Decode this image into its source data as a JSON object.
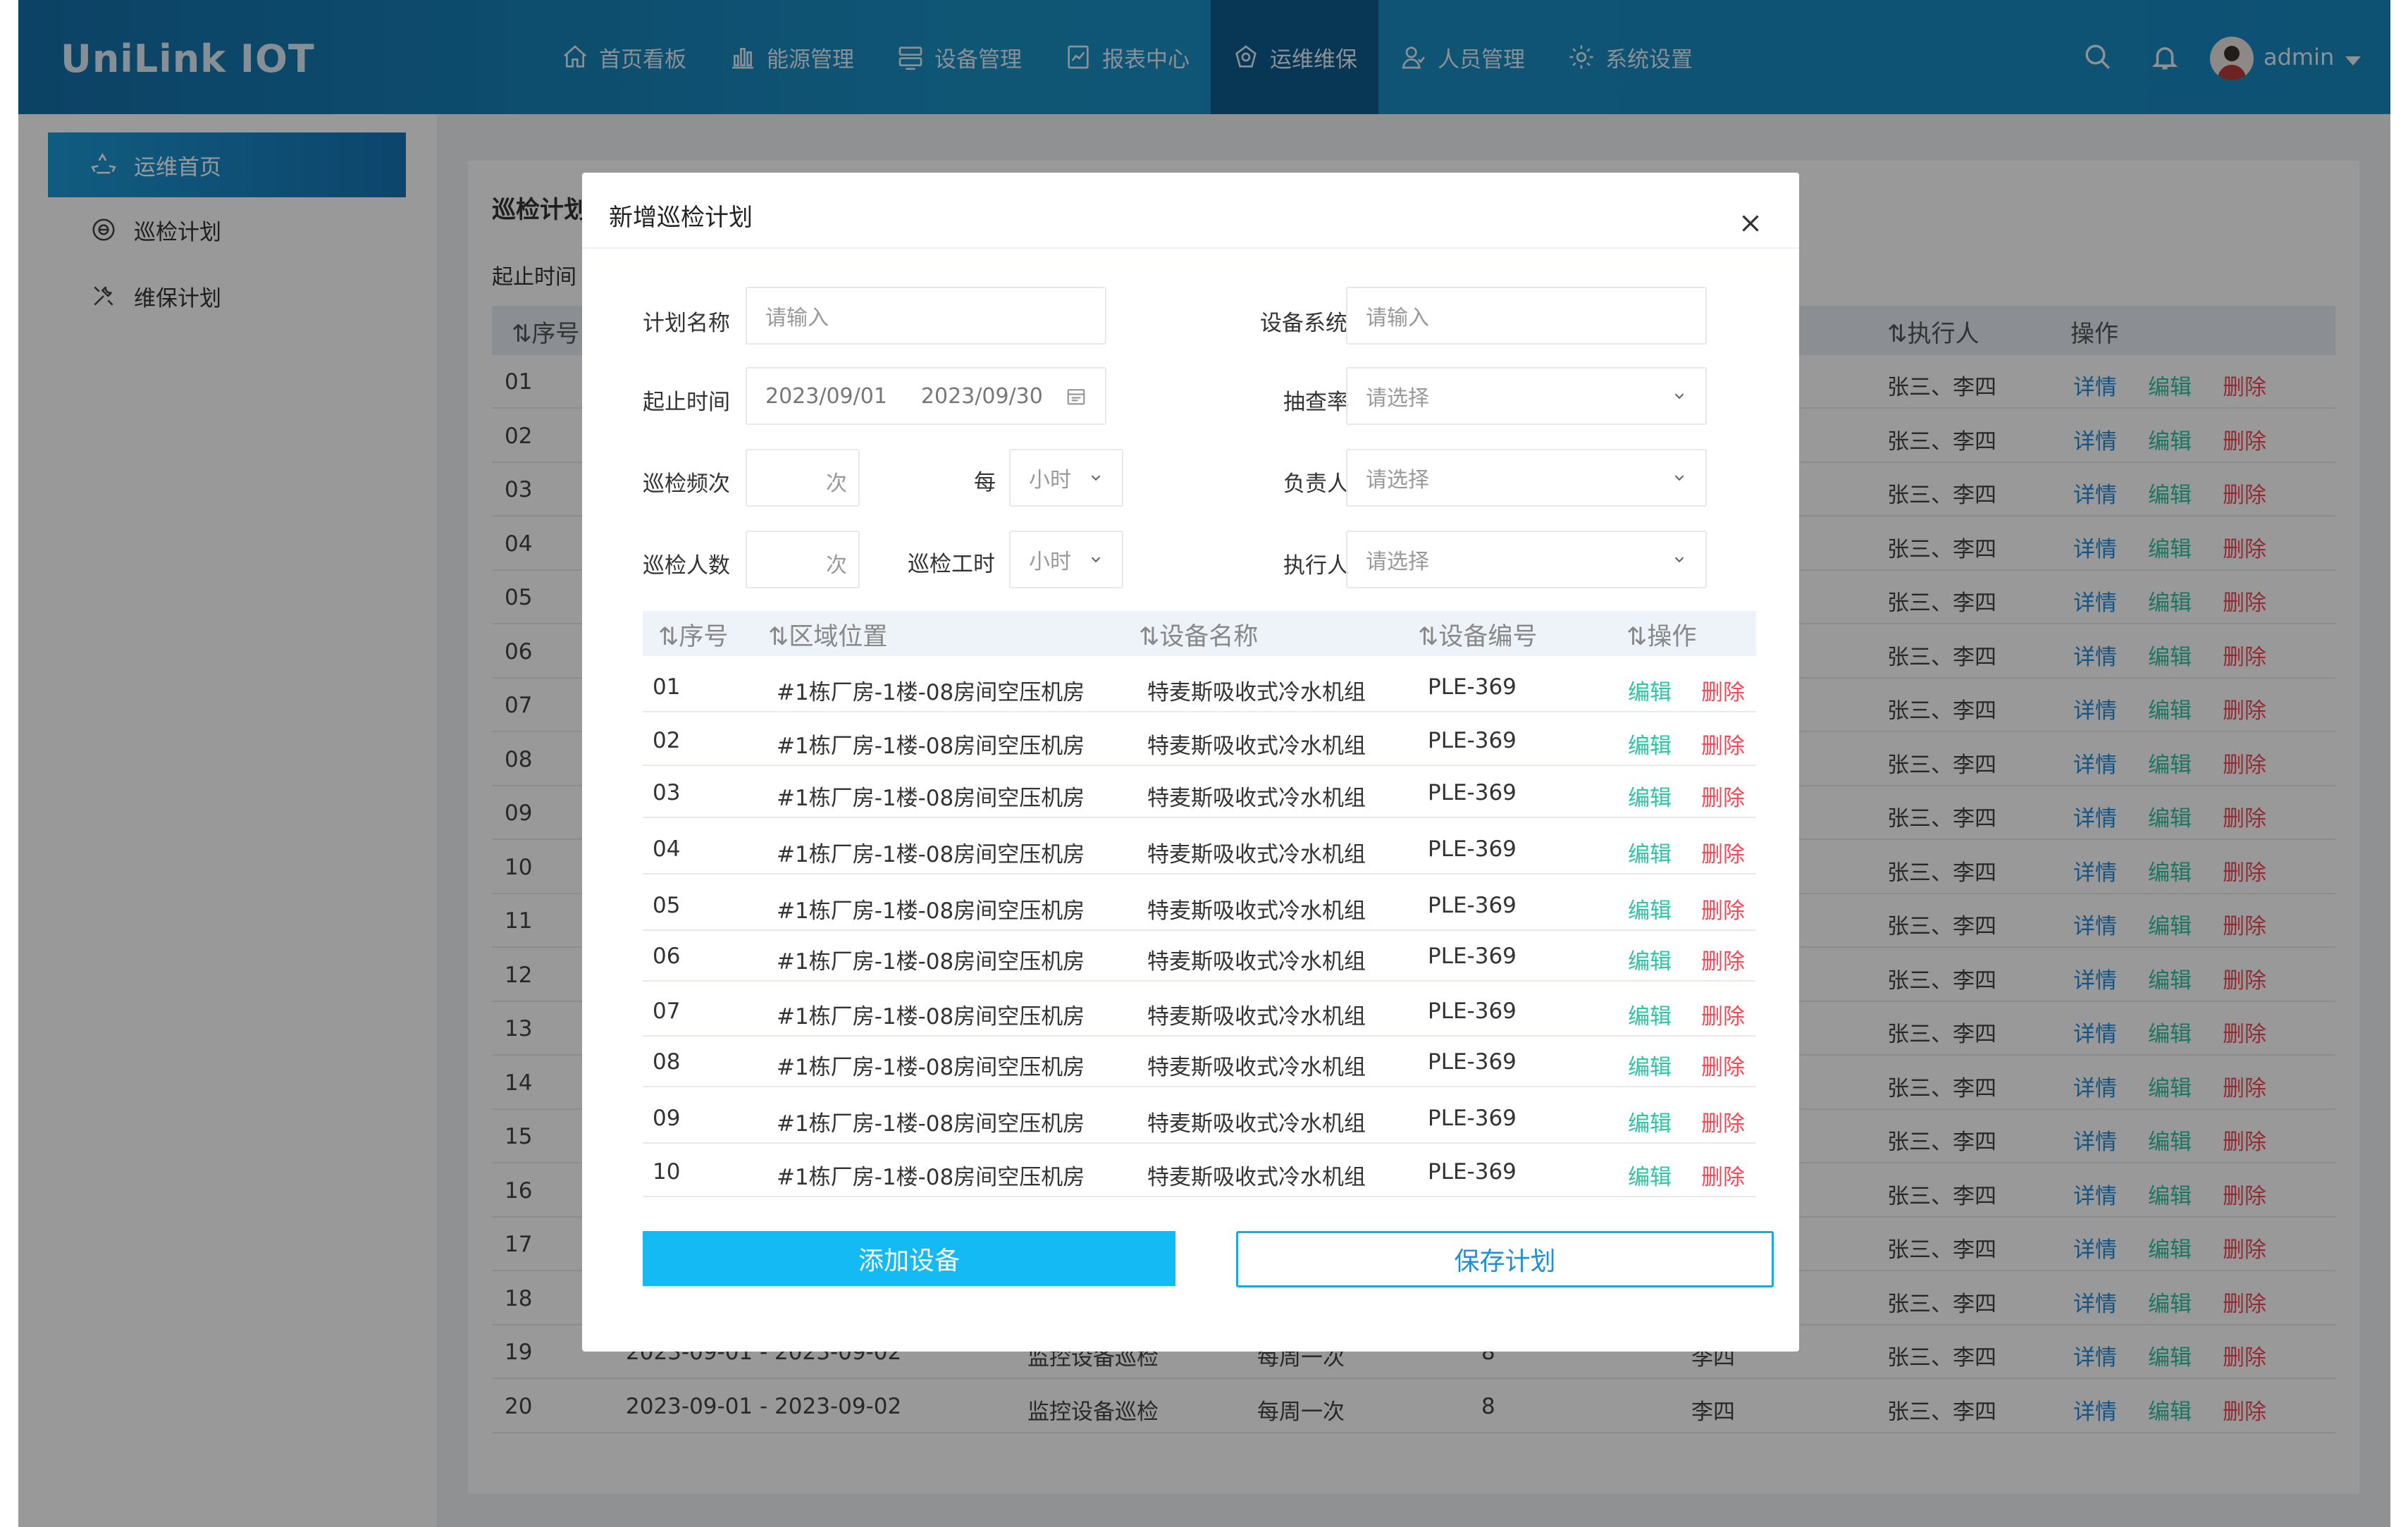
{
  "app": {
    "logo": "UniLink IOT",
    "user": "admin"
  },
  "nav": [
    {
      "label": "首页看板",
      "icon": "home-icon"
    },
    {
      "label": "能源管理",
      "icon": "bar-chart-icon"
    },
    {
      "label": "设备管理",
      "icon": "server-icon"
    },
    {
      "label": "报表中心",
      "icon": "report-icon"
    },
    {
      "label": "运维维保",
      "icon": "maintenance-icon",
      "active": true
    },
    {
      "label": "人员管理",
      "icon": "user-icon"
    },
    {
      "label": "系统设置",
      "icon": "gear-icon"
    }
  ],
  "sidebar": [
    {
      "label": "运维首页",
      "icon": "recycle-icon",
      "active": true
    },
    {
      "label": "巡检计划",
      "icon": "inspect-icon"
    },
    {
      "label": "维保计划",
      "icon": "tools-icon"
    }
  ],
  "background": {
    "title": "巡检计划",
    "filter_label": "起止时间",
    "headers": {
      "seq": "⇅序号",
      "executor": "⇅执行人",
      "ops": "操作"
    },
    "ops": {
      "detail": "详情",
      "edit": "编辑",
      "delete": "删除"
    },
    "executor": "张三、李四",
    "rows": [
      "01",
      "02",
      "03",
      "04",
      "05",
      "06",
      "07",
      "08",
      "09",
      "10",
      "11",
      "12",
      "13",
      "14",
      "15",
      "16",
      "17",
      "18",
      "19",
      "20"
    ],
    "row20": {
      "period": "2023-09-01 - 2023-09-02",
      "name": "监控设备巡检",
      "freq": "每周一次",
      "count": "8",
      "owner": "李四"
    },
    "row19": {
      "period": "2023-09-01 - 2023-09-02",
      "name": "监控设备巡检",
      "freq": "每周一次",
      "count": "8",
      "owner": "李四"
    }
  },
  "modal": {
    "title": "新增巡检计划",
    "form": {
      "plan_name_label": "计划名称",
      "plan_name_ph": "请输入",
      "system_label": "设备系统",
      "system_ph": "请输入",
      "period_label": "起止时间",
      "start_date": "2023/09/01",
      "end_date": "2023/09/30",
      "rate_label": "抽查率",
      "rate_ph": "请选择",
      "freq_label": "巡检频次",
      "freq_unit": "次",
      "per_label": "每",
      "per_unit": "小时",
      "owner_label": "负责人",
      "owner_ph": "请选择",
      "people_label": "巡检人数",
      "people_unit": "次",
      "hours_label": "巡检工时",
      "hours_unit": "小时",
      "executor_label": "执行人",
      "executor_ph": "请选择"
    },
    "table": {
      "headers": {
        "seq": "⇅序号",
        "location": "⇅区域位置",
        "device": "⇅设备名称",
        "code": "⇅设备编号",
        "ops": "⇅操作"
      },
      "edit": "编辑",
      "delete": "删除",
      "rows": [
        {
          "seq": "01",
          "location": "#1栋厂房-1楼-08房间空压机房",
          "device": "特麦斯吸收式冷水机组",
          "code": "PLE-369"
        },
        {
          "seq": "02",
          "location": "#1栋厂房-1楼-08房间空压机房",
          "device": "特麦斯吸收式冷水机组",
          "code": "PLE-369"
        },
        {
          "seq": "03",
          "location": "#1栋厂房-1楼-08房间空压机房",
          "device": "特麦斯吸收式冷水机组",
          "code": "PLE-369"
        },
        {
          "seq": "04",
          "location": "#1栋厂房-1楼-08房间空压机房",
          "device": "特麦斯吸收式冷水机组",
          "code": "PLE-369"
        },
        {
          "seq": "05",
          "location": "#1栋厂房-1楼-08房间空压机房",
          "device": "特麦斯吸收式冷水机组",
          "code": "PLE-369"
        },
        {
          "seq": "06",
          "location": "#1栋厂房-1楼-08房间空压机房",
          "device": "特麦斯吸收式冷水机组",
          "code": "PLE-369"
        },
        {
          "seq": "07",
          "location": "#1栋厂房-1楼-08房间空压机房",
          "device": "特麦斯吸收式冷水机组",
          "code": "PLE-369"
        },
        {
          "seq": "08",
          "location": "#1栋厂房-1楼-08房间空压机房",
          "device": "特麦斯吸收式冷水机组",
          "code": "PLE-369"
        },
        {
          "seq": "09",
          "location": "#1栋厂房-1楼-08房间空压机房",
          "device": "特麦斯吸收式冷水机组",
          "code": "PLE-369"
        },
        {
          "seq": "10",
          "location": "#1栋厂房-1楼-08房间空压机房",
          "device": "特麦斯吸收式冷水机组",
          "code": "PLE-369"
        }
      ]
    },
    "add_button": "添加设备",
    "save_button": "保存计划"
  }
}
